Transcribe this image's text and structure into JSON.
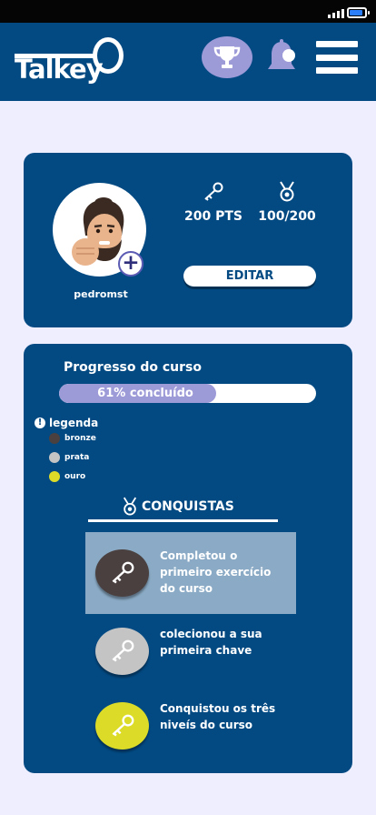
{
  "app": {
    "logo_text": "Talkey"
  },
  "colors": {
    "primary": "#034a83",
    "accent": "#9d9ad8",
    "background": "#eeeeff",
    "bronze": "#4a403f",
    "prata": "#c4c4c4",
    "ouro": "#dcdc28",
    "highlight": "#8aaac5"
  },
  "status_bar": {
    "battery_level": 0.85
  },
  "header": {
    "icons": [
      "trophy-icon",
      "bell-icon",
      "hamburger-menu-icon"
    ]
  },
  "profile": {
    "username": "pedromst",
    "points": "200 PTS",
    "medals": "100/200",
    "edit_label": "EDITAR"
  },
  "course": {
    "progress_title": "Progresso do curso",
    "progress_value": 0.61,
    "progress_label": "61% concluído",
    "legend_title": "legenda",
    "legend": [
      {
        "label": "bronze",
        "color": "#4a403f"
      },
      {
        "label": "prata",
        "color": "#c4c4c4"
      },
      {
        "label": "ouro",
        "color": "#dcdc28"
      }
    ],
    "achievements_title": "CONQUISTAS",
    "achievements": [
      {
        "text": "Completou o primeiro exercício do curso",
        "tier": "bronze",
        "highlighted": true
      },
      {
        "text": "colecionou a sua primeira chave",
        "tier": "prata",
        "highlighted": false
      },
      {
        "text": "Conquistou os três niveís do curso",
        "tier": "ouro",
        "highlighted": false
      }
    ]
  }
}
